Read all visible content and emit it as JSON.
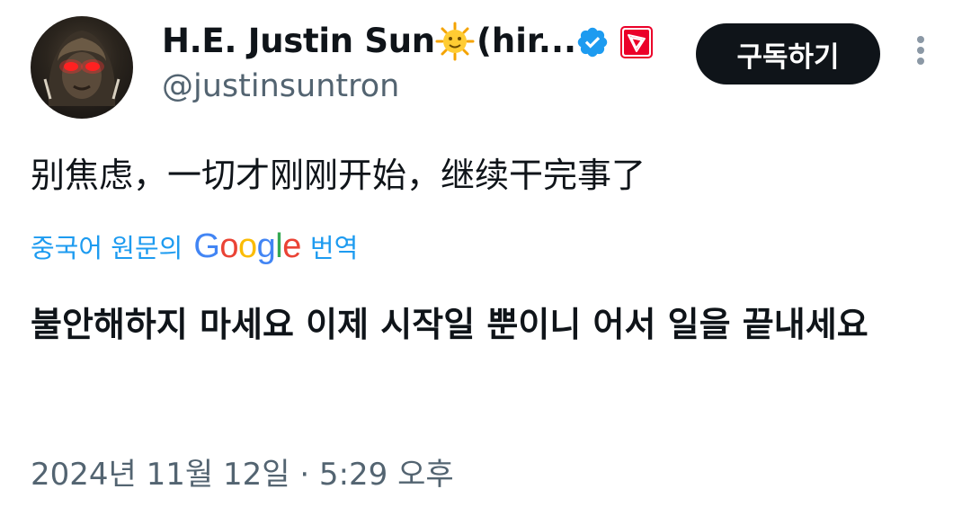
{
  "author": {
    "display_name": "H.E. Justin Sun",
    "display_name_suffix": "(hir...",
    "name_emoji": "sun-with-face-emoji",
    "handle": "@justinsuntron",
    "verified": true,
    "affiliation_badge": "tron-logo-icon"
  },
  "actions": {
    "subscribe_label": "구독하기",
    "more_icon": "more-vertical-icon"
  },
  "tweet": {
    "original_text": "别焦虑，一切才刚刚开始，继续干完事了",
    "translation_label": "중국어 원문의",
    "translation_provider_letters": [
      "G",
      "o",
      "o",
      "g",
      "l",
      "e"
    ],
    "translation_suffix": "번역",
    "translated_text": "불안해하지 마세요 이제 시작일 뿐이니 어서 일을 끝내세요",
    "timestamp": "2024년 11월 12일 · 5:29 오후"
  },
  "colors": {
    "link_blue": "#1d9bf0",
    "secondary_text": "#536471",
    "button_bg": "#0f1419",
    "verified_blue": "#1d9bf0",
    "tron_red": "#eb0029"
  }
}
